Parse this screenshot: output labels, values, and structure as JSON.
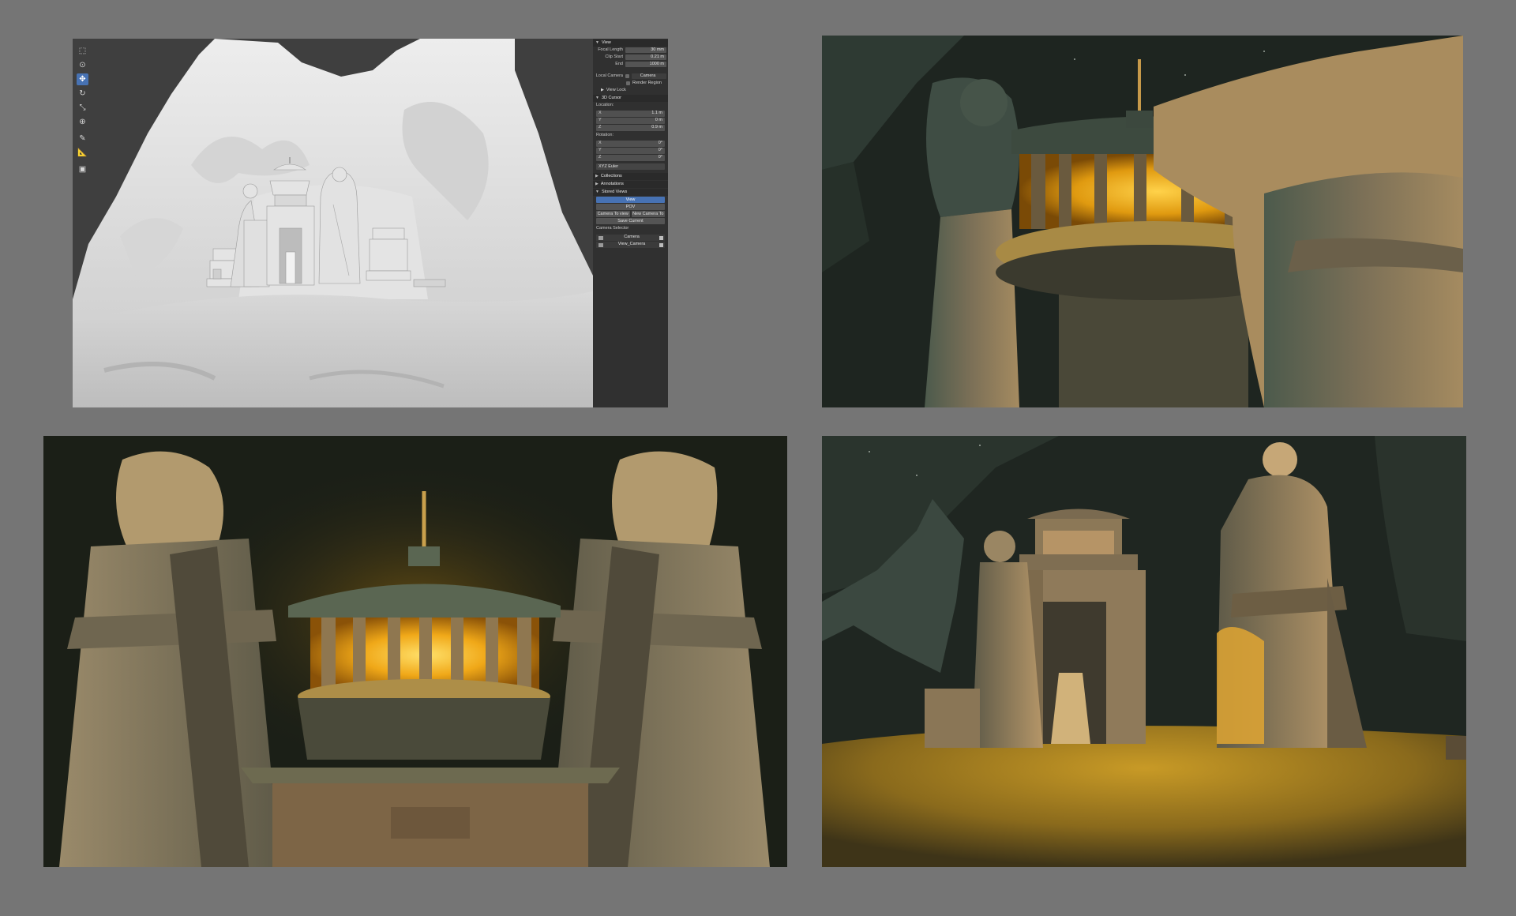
{
  "viewport": {
    "toolbar": {
      "tools": [
        {
          "name": "select-tool-icon",
          "glyph": "⬚",
          "active": false
        },
        {
          "name": "cursor-tool-icon",
          "glyph": "⊙",
          "active": false
        },
        {
          "name": "move-tool-icon",
          "glyph": "✥",
          "active": true
        },
        {
          "name": "rotate-tool-icon",
          "glyph": "↻",
          "active": false
        },
        {
          "name": "scale-tool-icon",
          "glyph": "⤡",
          "active": false
        },
        {
          "name": "transform-tool-icon",
          "glyph": "⊕",
          "active": false
        },
        {
          "name": "annotate-tool-icon",
          "glyph": "✎",
          "active": false
        },
        {
          "name": "measure-tool-icon",
          "glyph": "📐",
          "active": false
        },
        {
          "name": "add-cube-tool-icon",
          "glyph": "▣",
          "active": false
        }
      ]
    },
    "sidebar": {
      "view_section": "View",
      "focal_length_label": "Focal Length",
      "focal_length_value": "30 mm",
      "clip_start_label": "Clip Start",
      "clip_start_value": "0.21 m",
      "clip_end_label": "End",
      "clip_end_value": "1000 m",
      "local_camera_label": "Local Camera",
      "local_camera_value": "Camera",
      "render_region_label": "Render Region",
      "view_lock_label": "View Lock",
      "cursor_section": "3D Cursor",
      "location_label": "Location:",
      "location": [
        {
          "axis": "X",
          "value": "1.1 m"
        },
        {
          "axis": "Y",
          "value": "0 m"
        },
        {
          "axis": "Z",
          "value": "0.9 m"
        }
      ],
      "rotation_label": "Rotation:",
      "rotation": [
        {
          "axis": "X",
          "value": "0°"
        },
        {
          "axis": "Y",
          "value": "0°"
        },
        {
          "axis": "Z",
          "value": "0°"
        }
      ],
      "rotation_mode": "XYZ Euler",
      "collections_section": "Collections",
      "annotations_section": "Annotations",
      "stored_views_section": "Stored Views",
      "view_tab": "View",
      "pov_tab": "POV",
      "camera_to_view_button": "Camera To view",
      "new_camera_button": "New Camera To",
      "save_current_button": "Save Current",
      "camera_selector_label": "Camera Selector",
      "cameras": [
        "Camera",
        "View_Camera"
      ]
    }
  },
  "colors": {
    "background": "#757575",
    "active_tool": "#4772b3",
    "glow": "#f6b71e",
    "stone": "#8d7c60",
    "sky": "#1e2420"
  }
}
